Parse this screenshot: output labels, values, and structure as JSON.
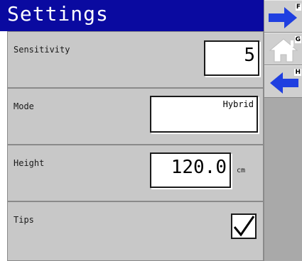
{
  "screen": {
    "title": "Settings"
  },
  "rows": [
    {
      "label": "Sensitivity",
      "value": "5"
    },
    {
      "label": "Mode",
      "value": "Hybrid"
    },
    {
      "label": "Height",
      "value": "120.0",
      "unit": "cm"
    },
    {
      "label": "Tips",
      "checked": true
    }
  ],
  "side_buttons": [
    {
      "icon": "arrow-right-icon",
      "key": "F"
    },
    {
      "icon": "home-icon",
      "key": "G"
    },
    {
      "icon": "arrow-left-icon",
      "key": "H"
    }
  ],
  "colors": {
    "title_bar": "#0a0aa0",
    "arrow": "#1f3fe0",
    "row_bg": "#c8c8c8",
    "sidebar_bg": "#a9a9a9"
  }
}
